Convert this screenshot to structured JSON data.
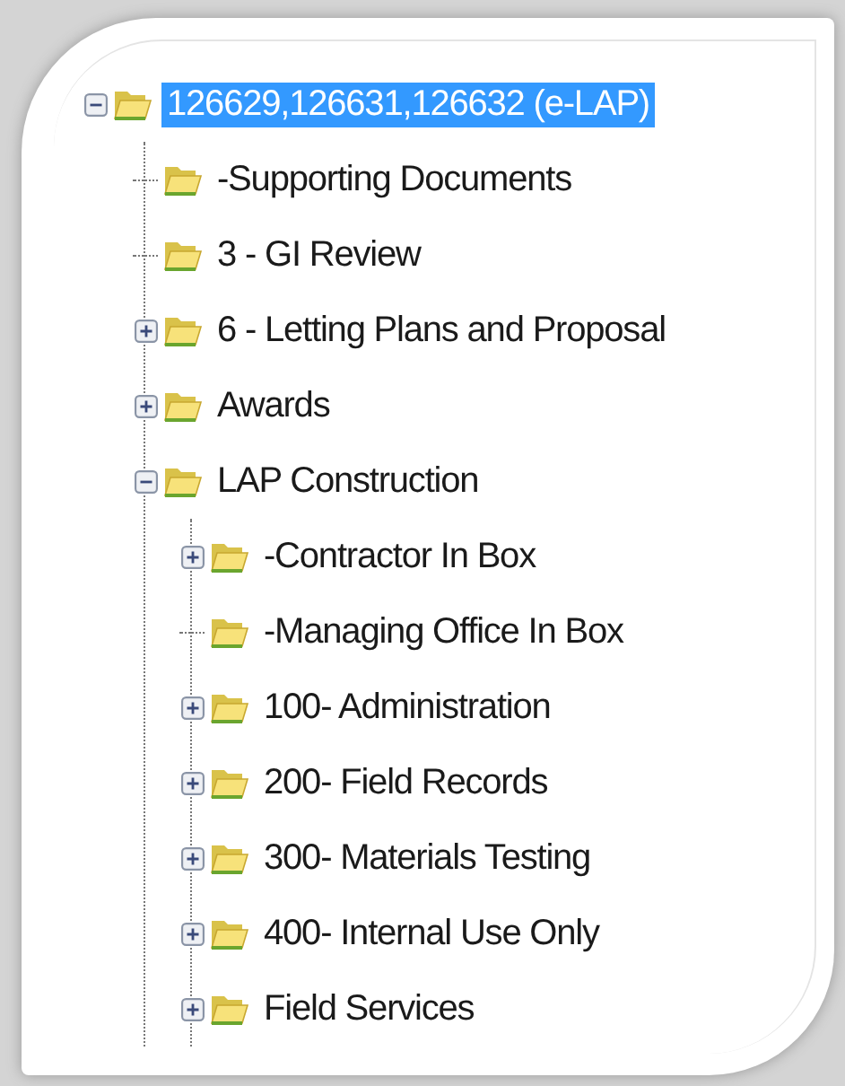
{
  "tree": [
    {
      "label": "126629,126631,126632 (e-LAP)",
      "selected": true,
      "kind": "branch",
      "expanded": true,
      "children": [
        {
          "label": "-Supporting Documents",
          "selected": false,
          "kind": "leaf"
        },
        {
          "label": "3 - GI Review",
          "selected": false,
          "kind": "leaf"
        },
        {
          "label": "6 - Letting Plans and Proposal",
          "selected": false,
          "kind": "branch",
          "expanded": false
        },
        {
          "label": "Awards",
          "selected": false,
          "kind": "branch",
          "expanded": false
        },
        {
          "label": "LAP Construction",
          "selected": false,
          "kind": "branch",
          "expanded": true,
          "children": [
            {
              "label": "-Contractor In Box",
              "selected": false,
              "kind": "branch",
              "expanded": false
            },
            {
              "label": "-Managing Office In Box",
              "selected": false,
              "kind": "leaf"
            },
            {
              "label": "100- Administration",
              "selected": false,
              "kind": "branch",
              "expanded": false
            },
            {
              "label": "200- Field Records",
              "selected": false,
              "kind": "branch",
              "expanded": false
            },
            {
              "label": "300- Materials Testing",
              "selected": false,
              "kind": "branch",
              "expanded": false
            },
            {
              "label": "400- Internal Use Only",
              "selected": false,
              "kind": "branch",
              "expanded": false
            },
            {
              "label": "Field Services",
              "selected": false,
              "kind": "branch",
              "expanded": false
            }
          ]
        }
      ]
    }
  ]
}
